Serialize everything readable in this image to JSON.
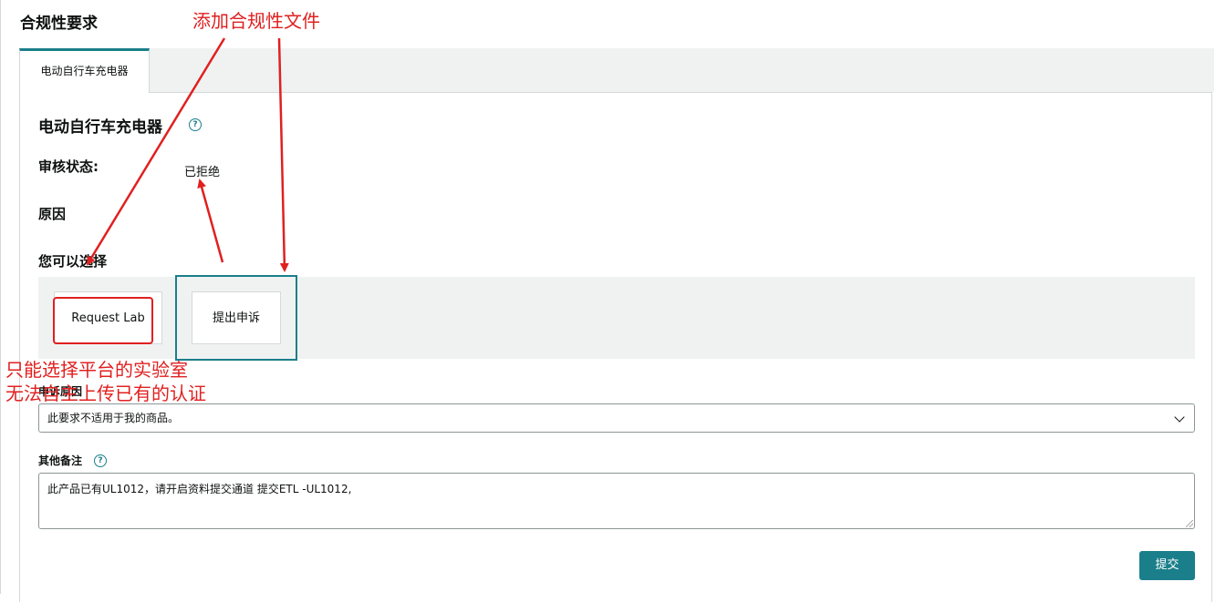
{
  "header": {
    "title": "合规性要求"
  },
  "tabs": [
    {
      "label": "电动自行车充电器"
    }
  ],
  "section": {
    "title": "电动自行车充电器",
    "status_label": "审核状态:",
    "status_value": "已拒绝",
    "reason_label": "原因",
    "choose_label": "您可以选择"
  },
  "options": {
    "request_lab": "Request Lab",
    "appeal": "提出申诉"
  },
  "form": {
    "appeal_reason_label": "申诉原因",
    "appeal_reason_value": "此要求不适用于我的商品。",
    "notes_label": "其他备注",
    "notes_value": "此产品已有UL1012，请开启资料提交通道 提交ETL -UL1012,",
    "submit_label": "提交"
  },
  "annotations": {
    "add_files": "添加合规性文件",
    "lab_only_line1": "只能选择平台的实验室",
    "lab_only_line2": "无法自主上传已有的认证"
  },
  "colors": {
    "accent": "#1a7f8a",
    "annotation": "#e02020",
    "band": "#f0f2f2"
  },
  "icons": {
    "help": "help-icon",
    "dropdown": "chevron-down-icon"
  }
}
